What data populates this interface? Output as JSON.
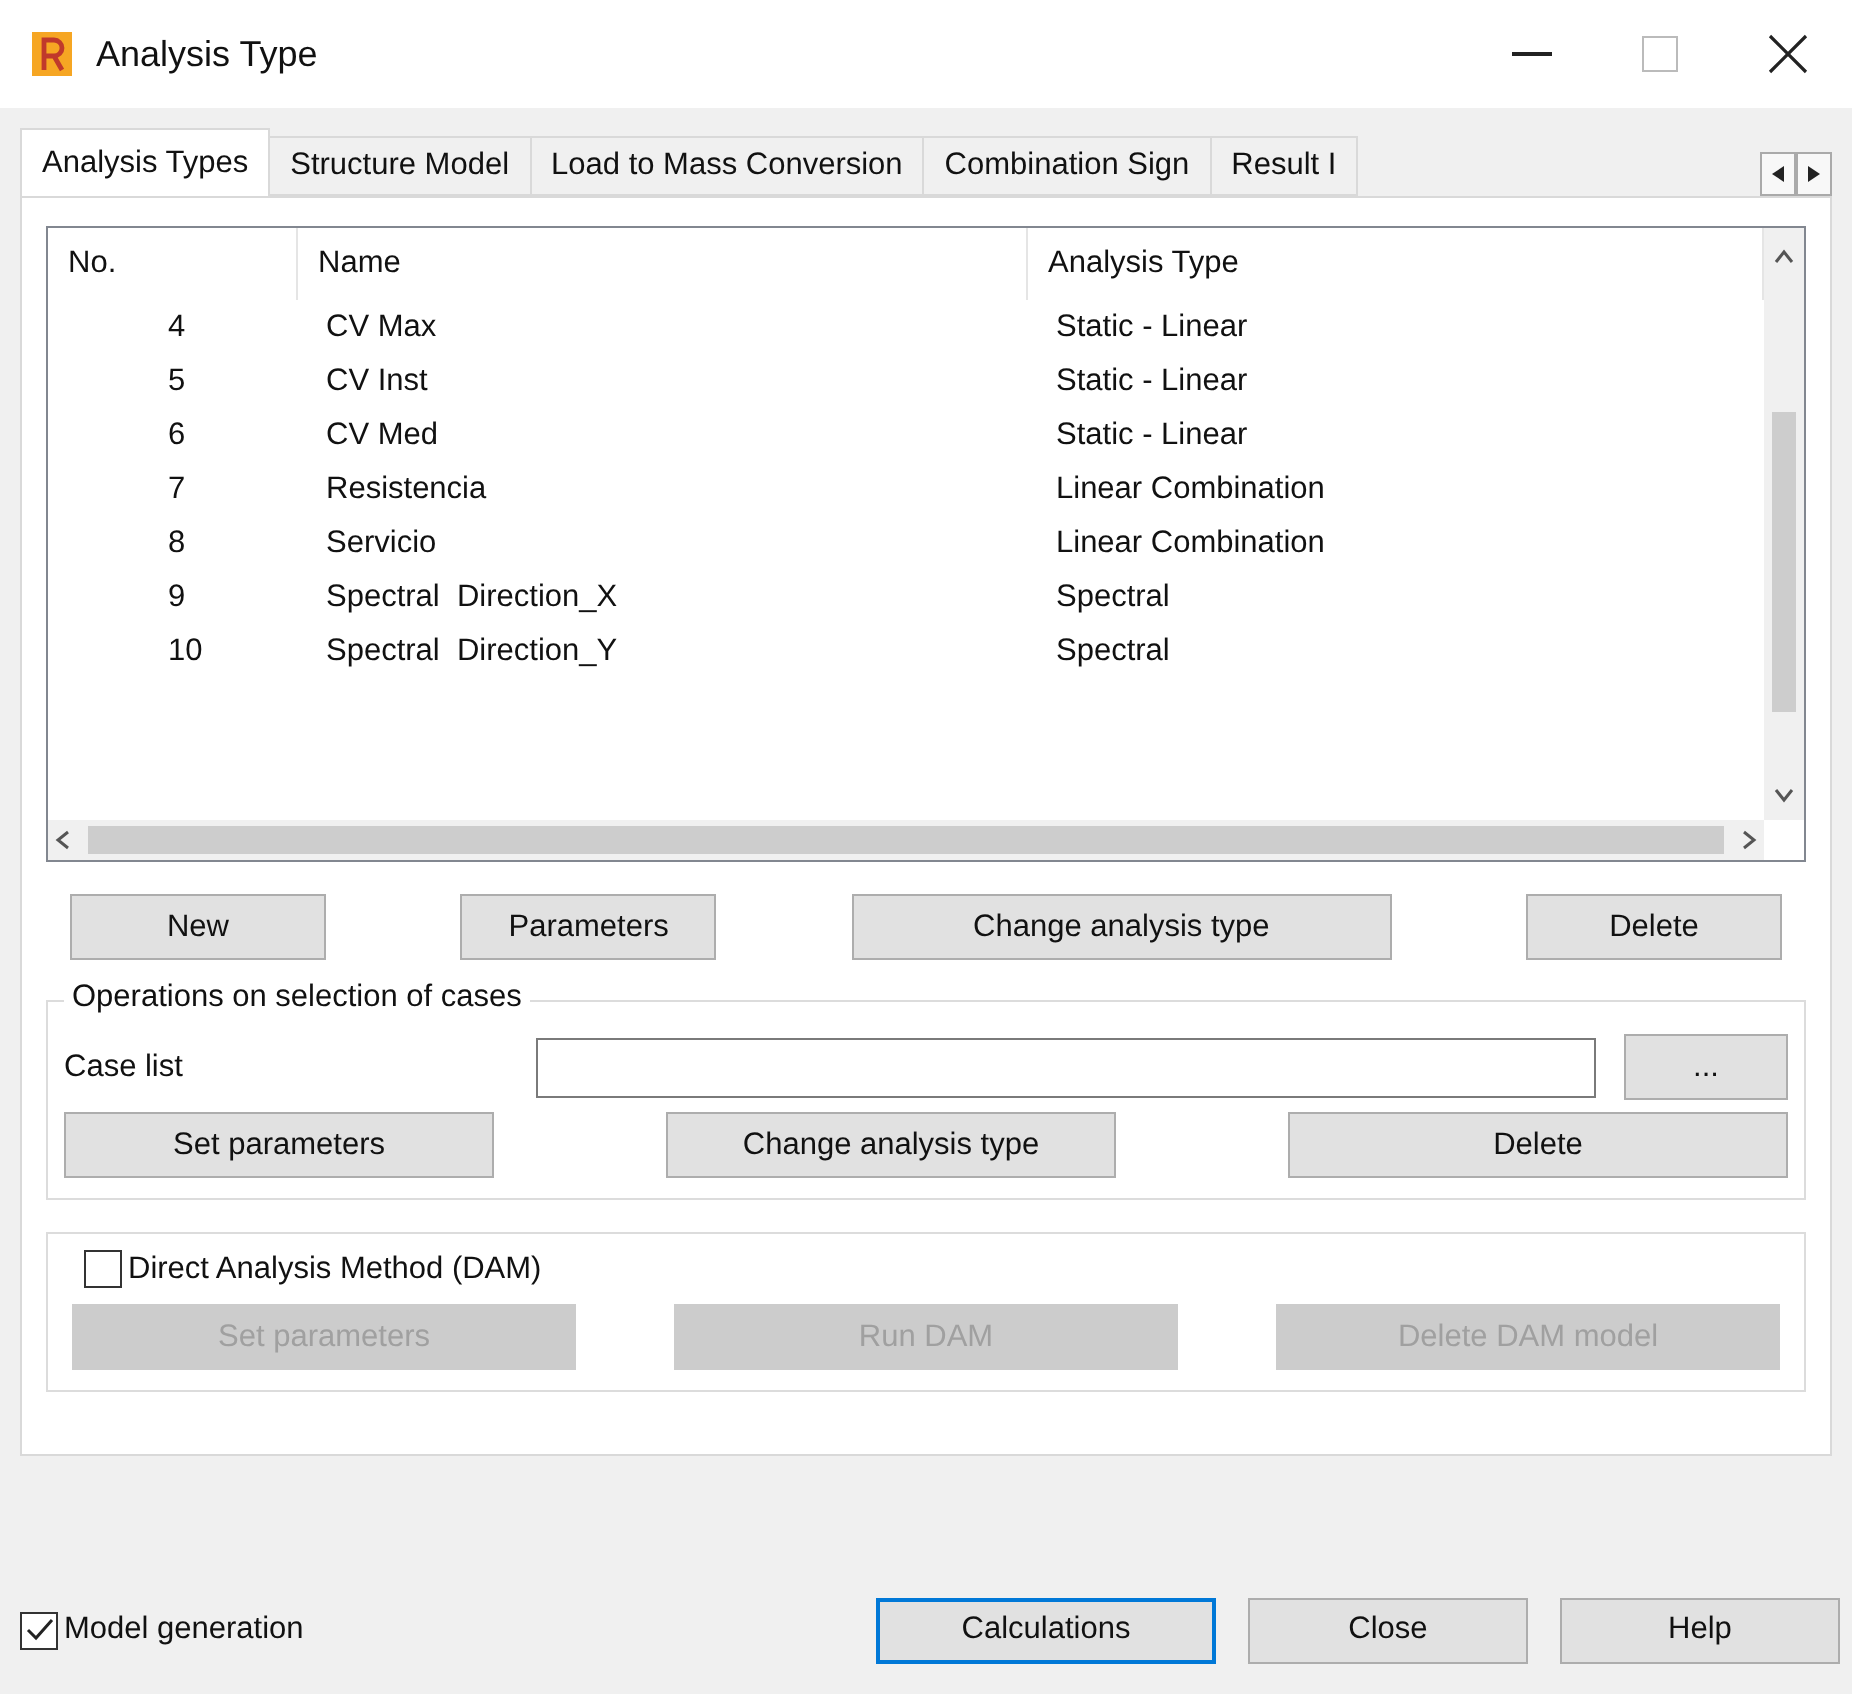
{
  "window": {
    "title": "Analysis Type"
  },
  "tabs": [
    {
      "label": "Analysis Types",
      "selected": true
    },
    {
      "label": "Structure Model",
      "selected": false
    },
    {
      "label": "Load to Mass Conversion",
      "selected": false
    },
    {
      "label": "Combination Sign",
      "selected": false
    },
    {
      "label": "Result I",
      "selected": false
    }
  ],
  "table": {
    "columns": [
      "No.",
      "Name",
      "Analysis Type"
    ],
    "rows": [
      [
        "4",
        "CV Max",
        "Static - Linear"
      ],
      [
        "5",
        "CV Inst",
        "Static - Linear"
      ],
      [
        "6",
        "CV Med",
        "Static - Linear"
      ],
      [
        "7",
        "Resistencia",
        "Linear Combination"
      ],
      [
        "8",
        "Servicio",
        "Linear Combination"
      ],
      [
        "9",
        "Spectral  Direction_X",
        "Spectral"
      ],
      [
        "10",
        "Spectral  Direction_Y",
        "Spectral"
      ]
    ]
  },
  "case_buttons": [
    {
      "label": "New",
      "disabled": false
    },
    {
      "label": "Parameters",
      "disabled": false
    },
    {
      "label": "Change analysis type",
      "disabled": false
    },
    {
      "label": "Delete",
      "disabled": false
    }
  ],
  "operations": {
    "title": "Operations on selection of cases",
    "case_list_label": "Case list",
    "browse_label": "...",
    "buttons": [
      {
        "label": "Set parameters",
        "disabled": false
      },
      {
        "label": "Change analysis type",
        "disabled": false
      },
      {
        "label": "Delete",
        "disabled": false
      }
    ]
  },
  "dam": {
    "label": "Direct Analysis Method (DAM)",
    "checked": false,
    "buttons": [
      {
        "label": "Set parameters",
        "disabled": true
      },
      {
        "label": "Run DAM",
        "disabled": true
      },
      {
        "label": "Delete DAM model",
        "disabled": true
      }
    ]
  },
  "model_generation": {
    "label": "Model generation",
    "checked": true
  },
  "footer_buttons": [
    {
      "label": "Calculations",
      "default": true
    },
    {
      "label": "Close",
      "default": false
    },
    {
      "label": "Help",
      "default": false
    }
  ]
}
